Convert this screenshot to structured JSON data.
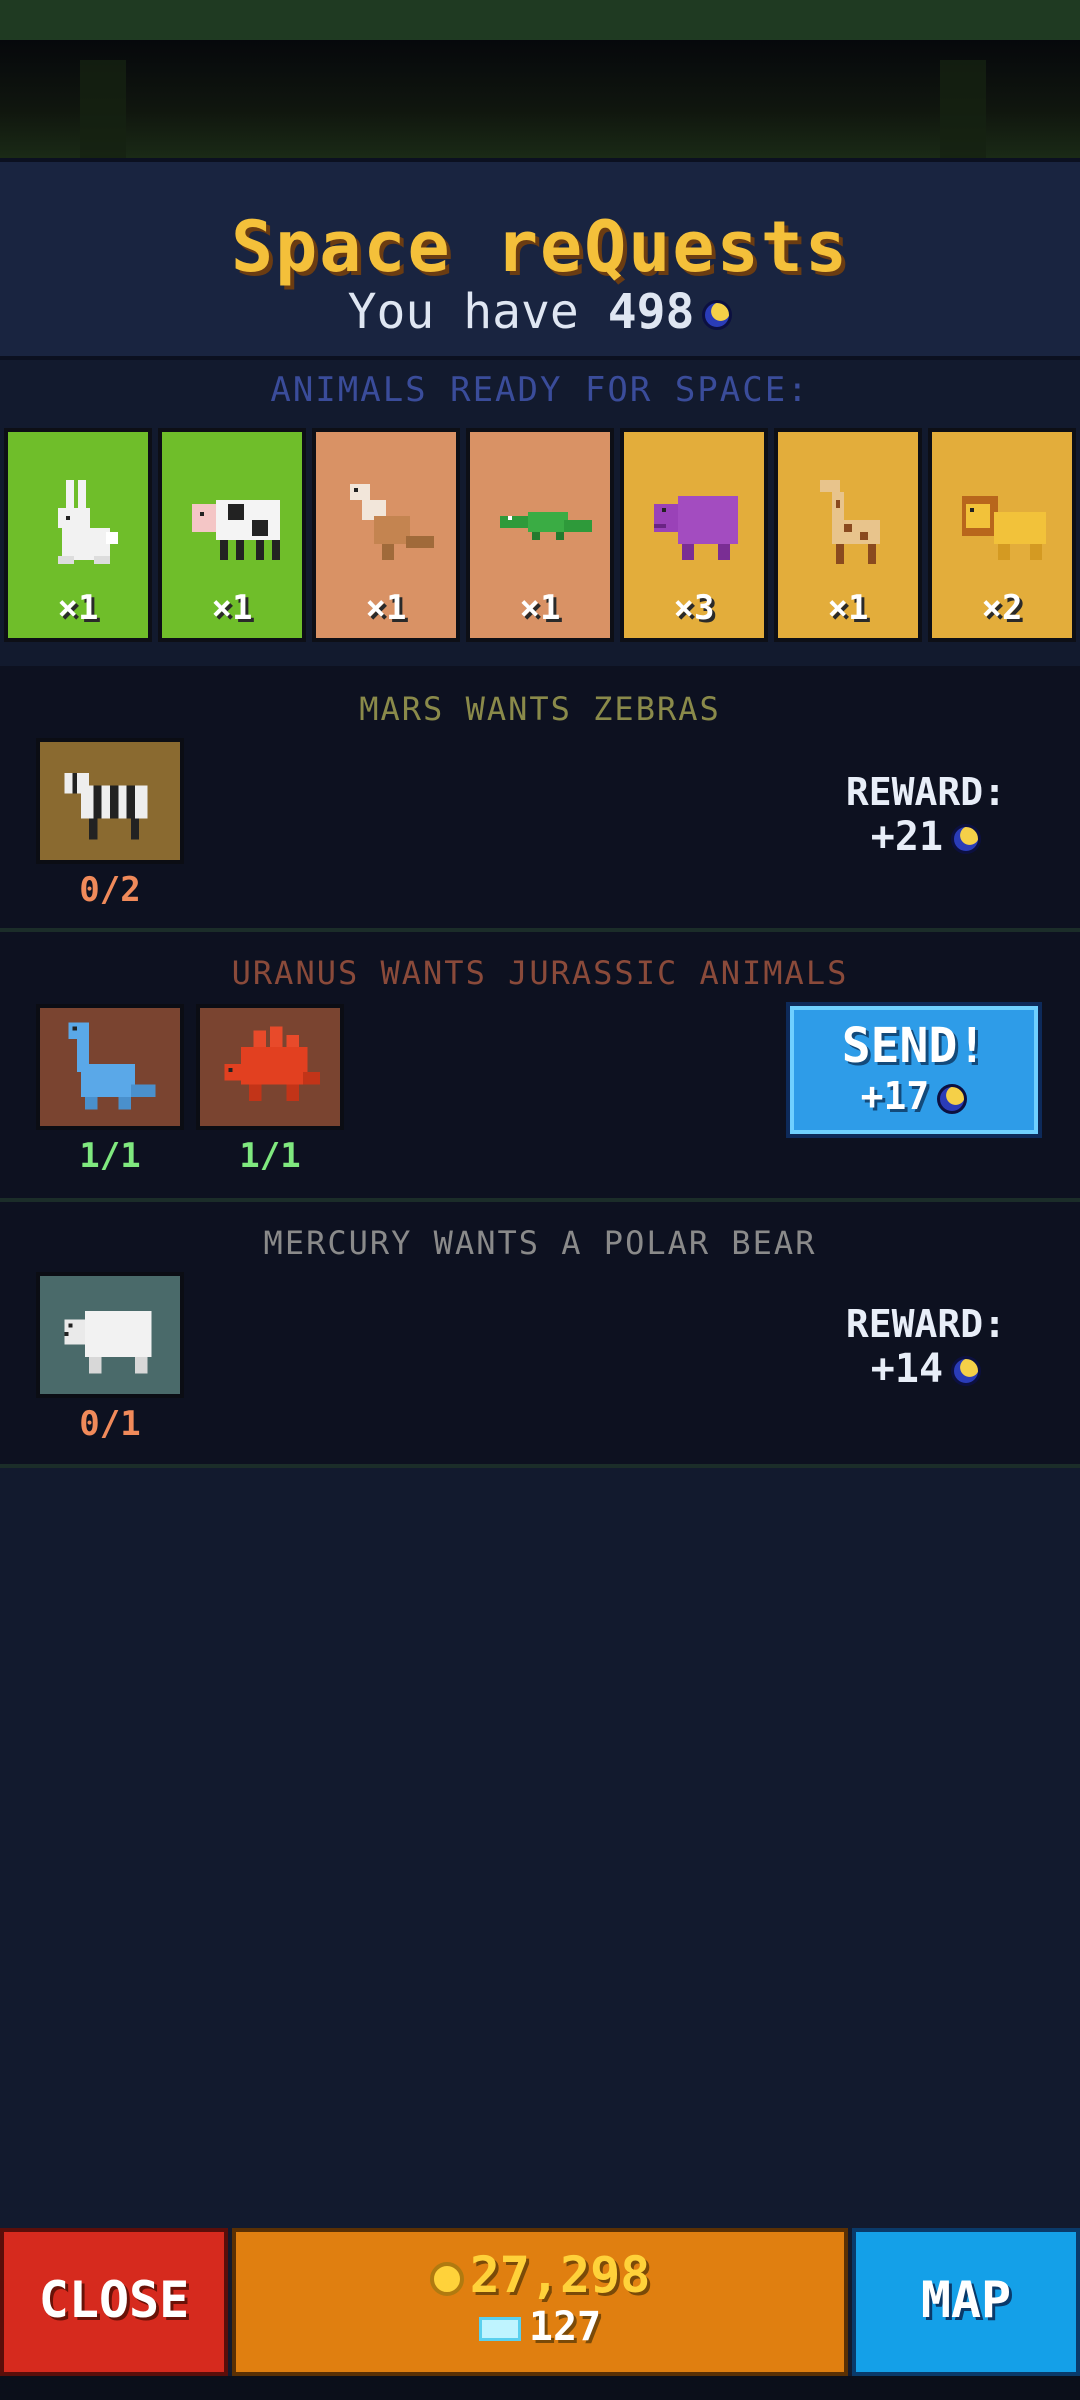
{
  "header": {
    "title": "Space reQuests",
    "you_have_label": "You have",
    "balance": "498"
  },
  "ready": {
    "label": "ANIMALS READY FOR SPACE:",
    "animals": [
      {
        "icon": "rabbit-icon",
        "count": "×1",
        "color": "#6fbe2a"
      },
      {
        "icon": "cow-icon",
        "count": "×1",
        "color": "#6fbe2a"
      },
      {
        "icon": "kangaroo-icon",
        "count": "×1",
        "color": "#d99265"
      },
      {
        "icon": "crocodile-icon",
        "count": "×1",
        "color": "#d99265"
      },
      {
        "icon": "hippo-icon",
        "count": "×3",
        "color": "#e3ad3b"
      },
      {
        "icon": "giraffe-icon",
        "count": "×1",
        "color": "#e3ad3b"
      },
      {
        "icon": "lion-icon",
        "count": "×2",
        "color": "#e3ad3b"
      }
    ]
  },
  "requests": [
    {
      "title": "MARS WANTS ZEBRAS",
      "title_color": "#8a8a4a",
      "slots": [
        {
          "icon": "zebra-icon",
          "progress": "0/2",
          "bg": "#8a6a30"
        }
      ],
      "reward_label": "REWARD:",
      "reward": "+21"
    },
    {
      "title": "URANUS WANTS JURASSIC ANIMALS",
      "title_color": "#8a4a3a",
      "slots": [
        {
          "icon": "brontosaurus-icon",
          "progress": "1/1",
          "bg": "#7a4430"
        },
        {
          "icon": "stegosaurus-icon",
          "progress": "1/1",
          "bg": "#7a4430"
        }
      ],
      "send_label": "SEND!",
      "reward": "+17"
    },
    {
      "title": "MERCURY WANTS A POLAR BEAR",
      "title_color": "#8a8a8a",
      "slots": [
        {
          "icon": "polar-bear-icon",
          "progress": "0/1",
          "bg": "#4a6a6a"
        }
      ],
      "reward_label": "REWARD:",
      "reward": "+14"
    }
  ],
  "bottom": {
    "close_label": "CLOSE",
    "coins": "27,298",
    "gems": "127",
    "map_label": "MAP"
  },
  "colors": {
    "title": "#f4c03a",
    "progress_incomplete": "#f08a5a",
    "progress_complete": "#7fe87f"
  }
}
